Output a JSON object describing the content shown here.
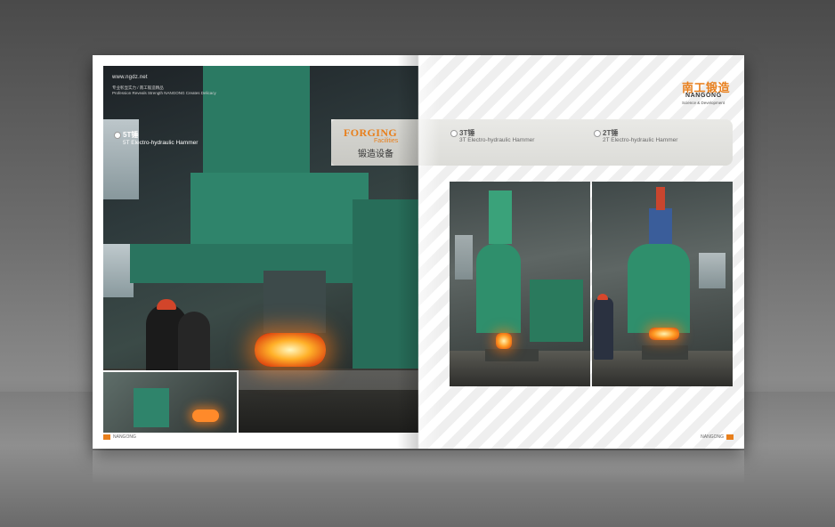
{
  "site": "www.ngdz.net",
  "slogan_cn": "专业彰显实力 / 南工锻造精品",
  "slogan_en": "Profession Reveals Strength NANGONG Creates Delicacy",
  "left_caption": {
    "title": "5T锤",
    "subtitle": "5T Electro-hydraulic Hammer"
  },
  "banner": {
    "forging": "FORGING",
    "facilities": "Facilities",
    "cn_title": "锻造设备"
  },
  "right_captions": [
    {
      "title": "3T锤",
      "subtitle": "3T Electro-hydraulic Hammer"
    },
    {
      "title": "2T锤",
      "subtitle": "2T Electro-hydraulic Hammer"
    }
  ],
  "logo": {
    "cn": "南工锻造",
    "en": "NANGONG",
    "tagline": "Science & Development"
  },
  "footer": {
    "left_brand": "NANGONG",
    "right_brand": "NANGONG"
  },
  "colors": {
    "accent": "#e87f1c",
    "machine_green": "#2f846b"
  }
}
